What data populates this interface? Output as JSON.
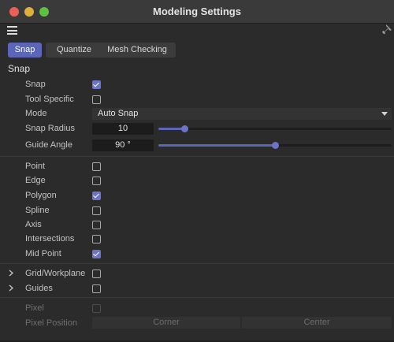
{
  "window": {
    "title": "Modeling Settings"
  },
  "tabs": [
    {
      "label": "Snap",
      "active": true
    },
    {
      "label": "Quantize",
      "active": false
    },
    {
      "label": "Mesh Checking",
      "active": false
    }
  ],
  "section": {
    "title": "Snap"
  },
  "snap": {
    "snap": {
      "label": "Snap",
      "checked": true
    },
    "tool_specific": {
      "label": "Tool Specific",
      "checked": false
    },
    "mode": {
      "label": "Mode",
      "value": "Auto Snap"
    },
    "snap_radius": {
      "label": "Snap Radius",
      "value": "10",
      "slider_fraction": 0.11
    },
    "guide_angle": {
      "label": "Guide Angle",
      "value": "90 °",
      "slider_fraction": 0.5
    }
  },
  "targets": {
    "point": {
      "label": "Point",
      "checked": false
    },
    "edge": {
      "label": "Edge",
      "checked": false
    },
    "polygon": {
      "label": "Polygon",
      "checked": true
    },
    "spline": {
      "label": "Spline",
      "checked": false
    },
    "axis": {
      "label": "Axis",
      "checked": false
    },
    "intersections": {
      "label": "Intersections",
      "checked": false
    },
    "mid_point": {
      "label": "Mid Point",
      "checked": true
    }
  },
  "groups": {
    "grid_workplane": {
      "label": "Grid/Workplane",
      "checked": false
    },
    "guides": {
      "label": "Guides",
      "checked": false
    }
  },
  "pixel": {
    "pixel": {
      "label": "Pixel",
      "checked": false,
      "enabled": false
    },
    "pixel_position": {
      "label": "Pixel Position",
      "options": [
        "Corner",
        "Center"
      ]
    }
  },
  "colors": {
    "accent": "#5b66b8",
    "background": "#2b2b2b"
  }
}
